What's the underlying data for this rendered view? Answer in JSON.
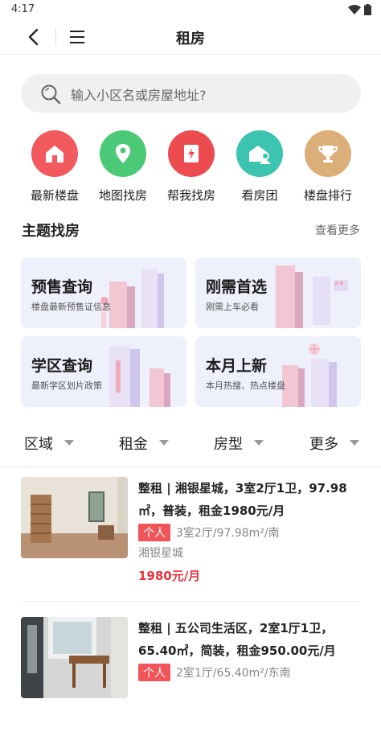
{
  "status": {
    "time": "4:17"
  },
  "nav": {
    "title": "租房"
  },
  "search": {
    "placeholder": "输入小区名或房屋地址?"
  },
  "quick_actions": [
    {
      "label": "最新楼盘",
      "icon": "house-icon",
      "color": "#f25a5f"
    },
    {
      "label": "地图找房",
      "icon": "map-pin-icon",
      "color": "#4cc976"
    },
    {
      "label": "帮我找房",
      "icon": "document-flash-icon",
      "color": "#ec4c4f"
    },
    {
      "label": "看房团",
      "icon": "house-group-icon",
      "color": "#3cc4b0"
    },
    {
      "label": "楼盘排行",
      "icon": "trophy-icon",
      "color": "#dcaf78"
    }
  ],
  "topic": {
    "title": "主题找房",
    "more": "查看更多"
  },
  "cards": [
    {
      "title": "预售查询",
      "subtitle": "楼盘最新预售证信息"
    },
    {
      "title": "刚需首选",
      "subtitle": "刚需上车必看"
    },
    {
      "title": "学区查询",
      "subtitle": "最新学区划片政策"
    },
    {
      "title": "本月上新",
      "subtitle": "本月热搜、热点楼盘"
    }
  ],
  "filters": [
    "区域",
    "租金",
    "房型",
    "更多"
  ],
  "listings": [
    {
      "title": "整租 | 湘银星城，3室2厅1卫，97.98㎡，普装，租金1980元/月",
      "tag": "个人",
      "info": "3室2厅/97.98m²/南",
      "community": "湘银星城",
      "price": "1980元/月"
    },
    {
      "title": "整租 | 五公司生活区，2室1厅1卫，65.40㎡，简装，租金950.00元/月",
      "tag": "个人",
      "info": "2室1厅/65.40m²/东南",
      "community": "",
      "price": ""
    }
  ],
  "colors": {
    "accent": "#e8323c",
    "tag_bg": "#f0555a"
  }
}
